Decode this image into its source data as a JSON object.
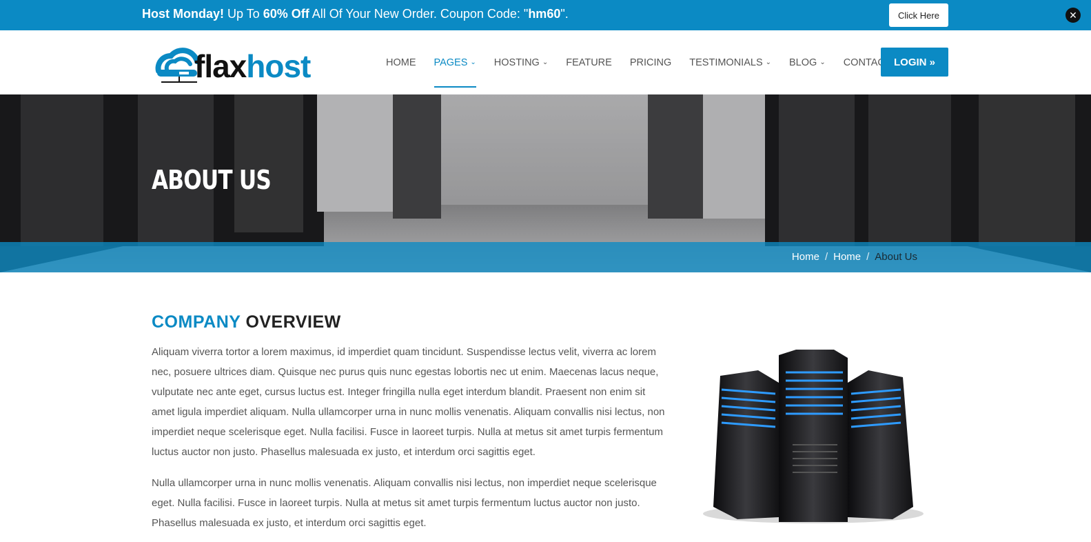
{
  "promo": {
    "strong1": "Host Monday!",
    "text1": " Up To ",
    "strong2": "60% Off",
    "text2": " All Of Your New Order. Coupon Code: \"",
    "code": "hm60",
    "text3": "\".",
    "button_label": "Click Here",
    "close_icon": "close-icon"
  },
  "brand": {
    "logo_part1": "flax",
    "logo_part2": "host"
  },
  "nav": {
    "items": [
      {
        "label": "HOME",
        "has_dropdown": false
      },
      {
        "label": "PAGES",
        "has_dropdown": true,
        "active": true
      },
      {
        "label": "HOSTING",
        "has_dropdown": true
      },
      {
        "label": "FEATURE",
        "has_dropdown": false
      },
      {
        "label": "PRICING",
        "has_dropdown": false
      },
      {
        "label": "TESTIMONIALS",
        "has_dropdown": true
      },
      {
        "label": "BLOG",
        "has_dropdown": true
      },
      {
        "label": "CONTACT",
        "has_dropdown": false
      }
    ],
    "login_label": "LOGIN »"
  },
  "hero": {
    "title": "ABOUT US",
    "breadcrumb": [
      "Home",
      "Home",
      "About Us"
    ],
    "separator": "/"
  },
  "overview": {
    "title_part1": "COMPANY",
    "title_part2": "OVERVIEW",
    "paragraph1": "Aliquam viverra tortor a lorem maximus, id imperdiet quam tincidunt. Suspendisse lectus velit, viverra ac lorem nec, posuere ultrices diam. Quisque nec purus quis nunc egestas lobortis nec ut enim. Maecenas lacus neque, vulputate nec ante eget, cursus luctus est. Integer fringilla nulla eget interdum blandit. Praesent non enim sit amet ligula imperdiet aliquam. Nulla ullamcorper urna in nunc mollis venenatis. Aliquam convallis nisi lectus, non imperdiet neque scelerisque eget. Nulla facilisi. Fusce in laoreet turpis. Nulla at metus sit amet turpis fermentum luctus auctor non justo. Phasellus malesuada ex justo, et interdum orci sagittis eget.",
    "paragraph2": "Nulla ullamcorper urna in nunc mollis venenatis. Aliquam convallis nisi lectus, non imperdiet neque scelerisque eget. Nulla facilisi. Fusce in laoreet turpis. Nulla at metus sit amet turpis fermentum luctus auctor non justo. Phasellus malesuada ex justo, et interdum orci sagittis eget."
  },
  "colors": {
    "brand_blue": "#0b8ac4",
    "dark": "#222222",
    "body_text": "#555555"
  }
}
